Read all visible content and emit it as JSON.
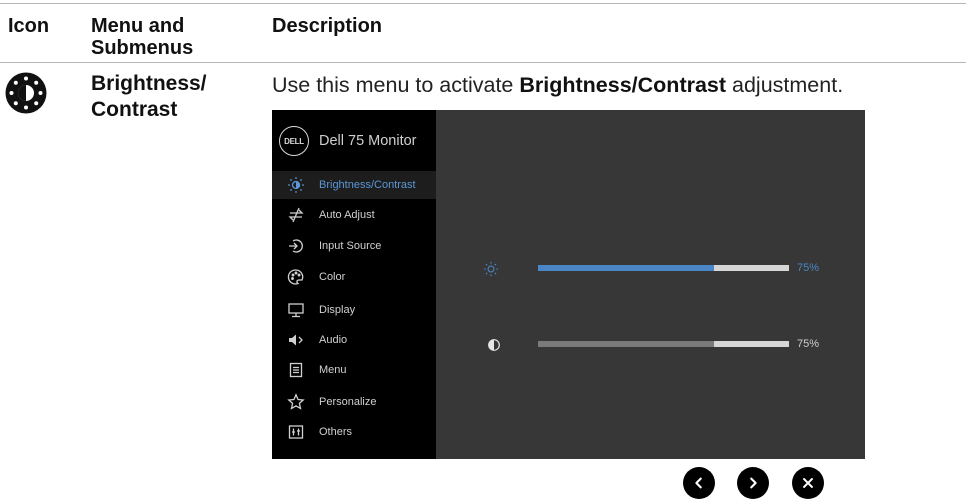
{
  "table": {
    "headers": {
      "icon": "Icon",
      "menu": "Menu and Submenus",
      "description": "Description"
    },
    "row": {
      "menu_title": "Brightness/ Contrast",
      "icon_name": "brightness-contrast-icon",
      "description": {
        "prefix": "Use this menu to activate ",
        "bold": "Brightness/Contrast",
        "suffix": " adjustment."
      }
    }
  },
  "osd": {
    "brand_logo": "DELL",
    "model": "Dell 75 Monitor",
    "menu_items": [
      {
        "label": "Brightness/Contrast",
        "icon": "brightness-icon",
        "active": true
      },
      {
        "label": "Auto Adjust",
        "icon": "auto-adjust-icon",
        "active": false
      },
      {
        "label": "Input Source",
        "icon": "input-source-icon",
        "active": false
      },
      {
        "label": "Color",
        "icon": "color-icon",
        "active": false
      },
      {
        "label": "Display",
        "icon": "display-icon",
        "active": false
      },
      {
        "label": "Audio",
        "icon": "audio-icon",
        "active": false
      },
      {
        "label": "Menu",
        "icon": "menu-icon",
        "active": false
      },
      {
        "label": "Personalize",
        "icon": "personalize-icon",
        "active": false
      },
      {
        "label": "Others",
        "icon": "others-icon",
        "active": false
      }
    ],
    "sliders": [
      {
        "name": "brightness",
        "icon": "brightness-icon",
        "level": 0.7,
        "value_label": "75%",
        "color": "#4a86c5",
        "label_color": "#4a86c5"
      },
      {
        "name": "contrast",
        "icon": "contrast-icon",
        "level": 0.7,
        "value_label": "75%",
        "color": "#7a7a7a",
        "label_color": "#cfcfcf"
      }
    ],
    "colors": {
      "accent": "#5b97d6",
      "panel_bg": "#373737",
      "sidebar_bg": "#000000"
    }
  },
  "nav_buttons": [
    {
      "name": "back",
      "icon": "chevron-left-icon"
    },
    {
      "name": "forward",
      "icon": "chevron-right-icon"
    },
    {
      "name": "close",
      "icon": "close-icon"
    }
  ]
}
